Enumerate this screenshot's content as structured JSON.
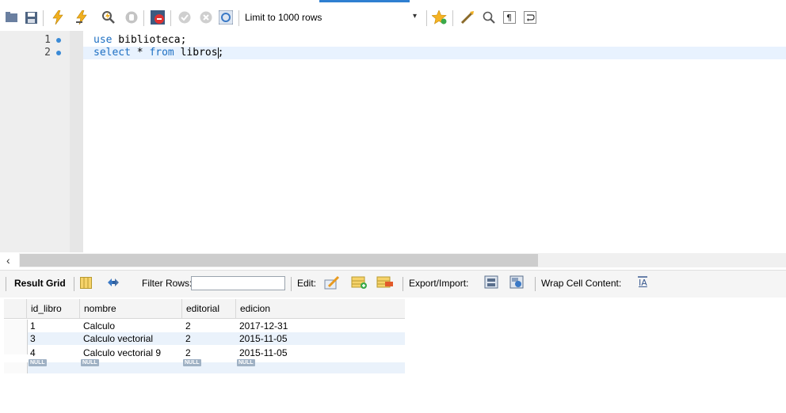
{
  "toolbar": {
    "limit_label": "Limit to 1000 rows",
    "icons": [
      "folder-icon",
      "save-icon",
      "execute-icon",
      "execute-current-icon",
      "explain-icon",
      "stop-icon",
      "toggle-error-icon",
      "commit-icon",
      "rollback-icon",
      "autocommit-icon",
      "bookmark-icon",
      "beautify-icon",
      "find-icon",
      "invisible-chars-icon",
      "wrap-icon"
    ]
  },
  "editor": {
    "lines": [
      {
        "num": "1",
        "keyword": "use",
        "rest": " biblioteca;"
      },
      {
        "num": "2",
        "keyword": "select",
        "rest_a": " * ",
        "keyword2": "from",
        "rest_b": " libros",
        "rest_c": ";"
      }
    ]
  },
  "results": {
    "result_grid_label": "Result Grid",
    "filter_rows_label": "Filter Rows:",
    "filter_value": "",
    "edit_label": "Edit:",
    "export_label": "Export/Import:",
    "wrap_label": "Wrap Cell Content:",
    "columns": [
      "id_libro",
      "nombre",
      "editorial",
      "edicion"
    ],
    "rows": [
      [
        "1",
        "Calculo",
        "2",
        "2017-12-31"
      ],
      [
        "3",
        "Calculo vectorial",
        "2",
        "2015-11-05"
      ],
      [
        "4",
        "Calculo vectorial 9",
        "2",
        "2015-11-05"
      ]
    ],
    "null_label": "NULL"
  },
  "colors": {
    "keyword": "#1d6fc3",
    "active_line": "#e8f2fe",
    "null_badge": "#9fb1c4"
  }
}
